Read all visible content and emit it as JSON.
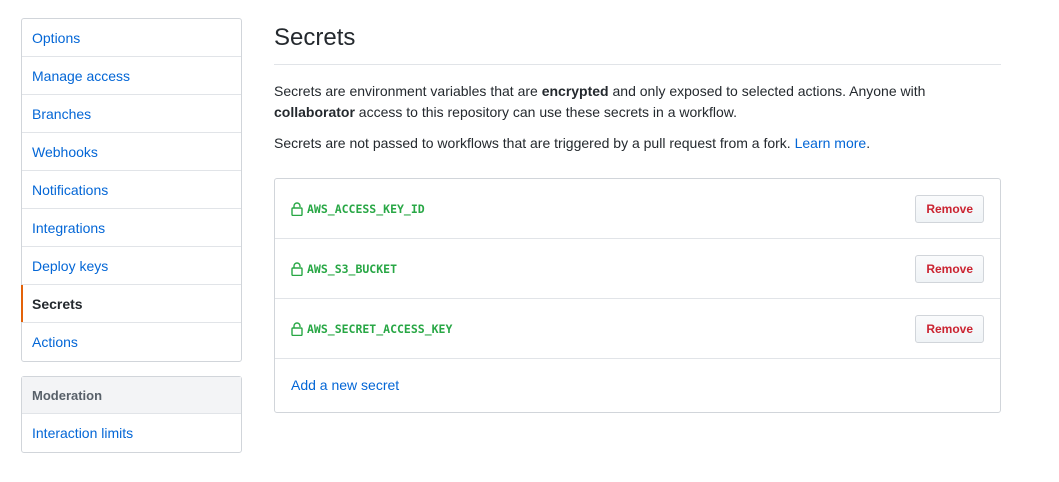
{
  "sidebar": {
    "items": [
      {
        "label": "Options",
        "selected": false
      },
      {
        "label": "Manage access",
        "selected": false
      },
      {
        "label": "Branches",
        "selected": false
      },
      {
        "label": "Webhooks",
        "selected": false
      },
      {
        "label": "Notifications",
        "selected": false
      },
      {
        "label": "Integrations",
        "selected": false
      },
      {
        "label": "Deploy keys",
        "selected": false
      },
      {
        "label": "Secrets",
        "selected": true
      },
      {
        "label": "Actions",
        "selected": false
      }
    ],
    "moderation": {
      "heading": "Moderation",
      "items": [
        {
          "label": "Interaction limits"
        }
      ]
    }
  },
  "main": {
    "title": "Secrets",
    "description": {
      "part1": "Secrets are environment variables that are ",
      "bold1": "encrypted",
      "part2": " and only exposed to selected actions. Anyone with ",
      "bold2": "collaborator",
      "part3": " access to this repository can use these secrets in a workflow."
    },
    "note": {
      "text": "Secrets are not passed to workflows that are triggered by a pull request from a fork. ",
      "link": "Learn more",
      "suffix": "."
    },
    "secrets": [
      {
        "name": "AWS_ACCESS_KEY_ID",
        "icon": "lock-icon",
        "remove_label": "Remove"
      },
      {
        "name": "AWS_S3_BUCKET",
        "icon": "lock-icon",
        "remove_label": "Remove"
      },
      {
        "name": "AWS_SECRET_ACCESS_KEY",
        "icon": "lock-icon",
        "remove_label": "Remove"
      }
    ],
    "add_secret_label": "Add a new secret"
  },
  "colors": {
    "link": "#0366d6",
    "secret_name": "#28a745",
    "danger": "#cb2431",
    "selected_indicator": "#e36209"
  }
}
